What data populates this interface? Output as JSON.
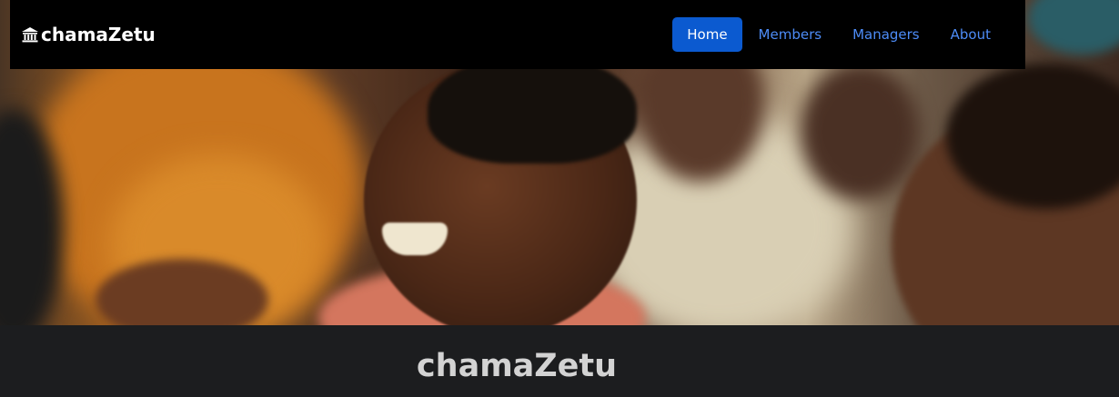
{
  "navbar": {
    "brand_label": "chamaZetu",
    "brand_icon": "bank-icon",
    "links": [
      {
        "label": "Home",
        "active": true
      },
      {
        "label": "Members",
        "active": false
      },
      {
        "label": "Managers",
        "active": false
      },
      {
        "label": "About",
        "active": false
      }
    ]
  },
  "main": {
    "heading": "chamaZetu"
  },
  "colors": {
    "navbar_bg": "#000000",
    "active_link_bg": "#0b5ad0",
    "link": "#4d8cf7",
    "page_bg": "#1c1d1f",
    "heading": "#d3d3d3"
  }
}
